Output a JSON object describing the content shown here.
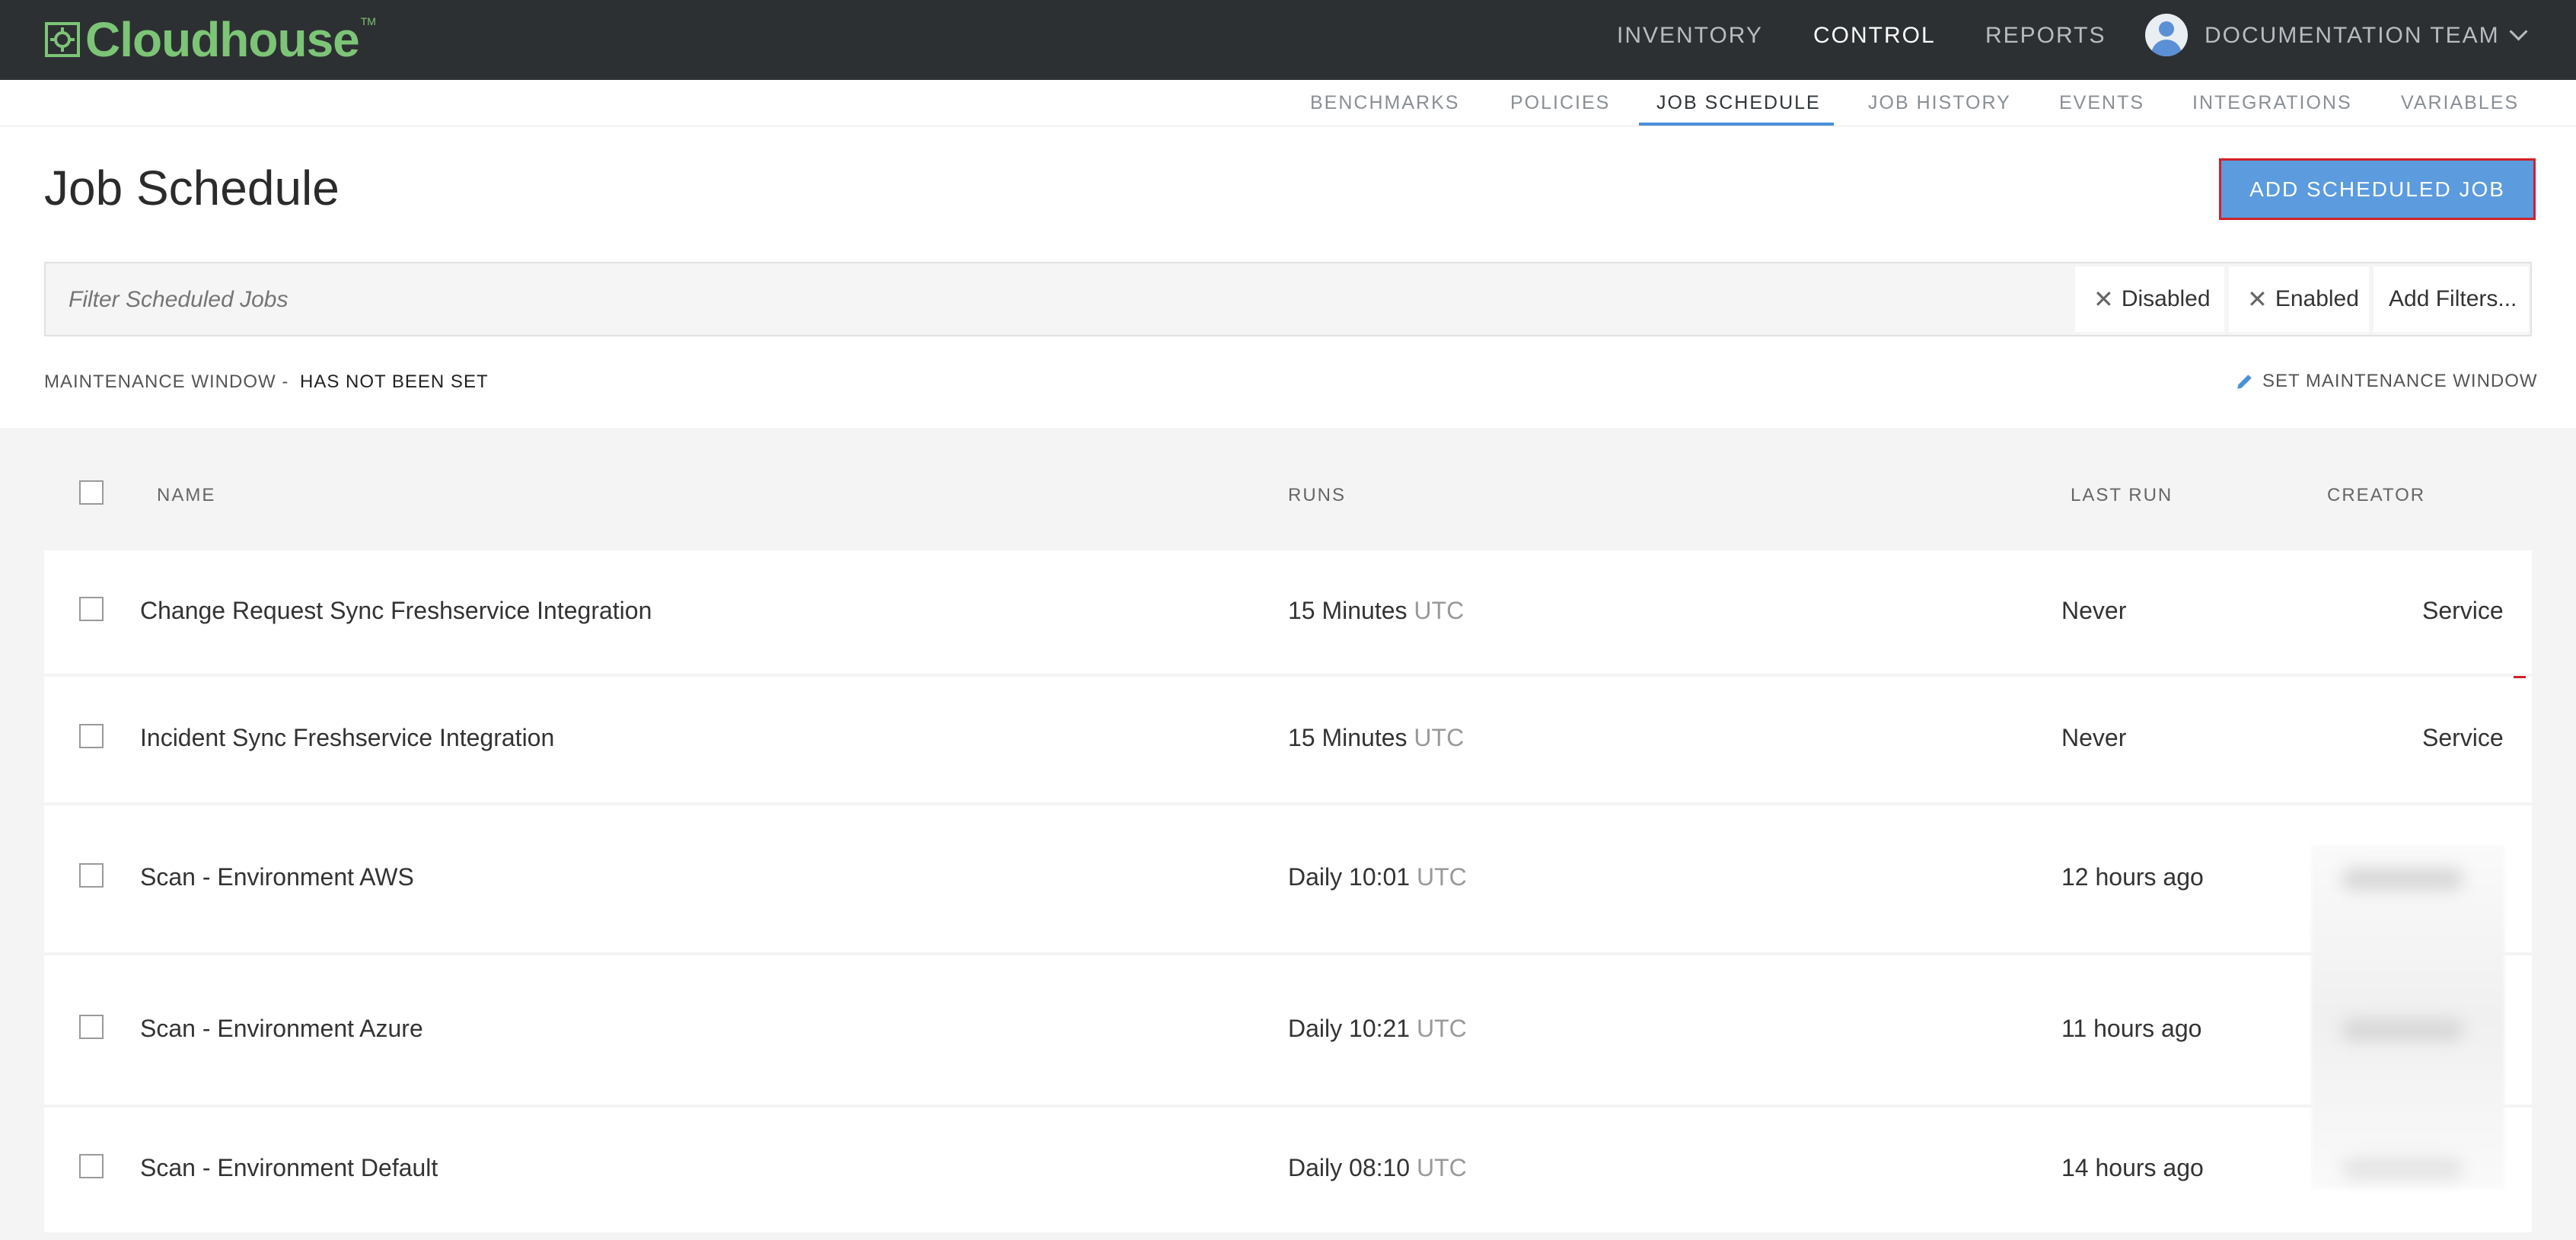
{
  "brand": {
    "name": "Cloudhouse",
    "tm": "TM"
  },
  "topnav": {
    "inventory": "INVENTORY",
    "control": "CONTROL",
    "reports": "REPORTS",
    "team": "DOCUMENTATION TEAM"
  },
  "subnav": {
    "benchmarks": "BENCHMARKS",
    "policies": "POLICIES",
    "job_schedule": "JOB SCHEDULE",
    "job_history": "JOB HISTORY",
    "events": "EVENTS",
    "integrations": "INTEGRATIONS",
    "variables": "VARIABLES"
  },
  "page": {
    "title": "Job Schedule",
    "add_button": "ADD SCHEDULED JOB"
  },
  "filter": {
    "placeholder": "Filter Scheduled Jobs",
    "chips": [
      "Disabled",
      "Enabled"
    ],
    "add_filters": "Add Filters..."
  },
  "maintenance": {
    "label": "MAINTENANCE WINDOW -",
    "value": "HAS NOT BEEN SET",
    "action": "SET MAINTENANCE WINDOW"
  },
  "table": {
    "columns": {
      "name": "NAME",
      "runs": "RUNS",
      "last_run": "LAST RUN",
      "creator": "CREATOR"
    },
    "rows": [
      {
        "name": "Change Request Sync Freshservice Integration",
        "runs": "15 Minutes",
        "tz": "UTC",
        "last_run": "Never",
        "creator": "Service"
      },
      {
        "name": "Incident Sync Freshservice Integration",
        "runs": "15 Minutes",
        "tz": "UTC",
        "last_run": "Never",
        "creator": "Service"
      },
      {
        "name": "Scan - Environment AWS",
        "runs": "Daily 10:01",
        "tz": "UTC",
        "last_run": "12 hours ago",
        "creator": ""
      },
      {
        "name": "Scan - Environment Azure",
        "runs": "Daily 10:21",
        "tz": "UTC",
        "last_run": "11 hours ago",
        "creator": ""
      },
      {
        "name": "Scan - Environment Default",
        "runs": "Daily 08:10",
        "tz": "UTC",
        "last_run": "14 hours ago",
        "creator": ""
      }
    ]
  },
  "colors": {
    "topbar": "#2d3033",
    "brand_green": "#7cc576",
    "accent_blue": "#5b9bde",
    "highlight_red": "#d3202a"
  }
}
